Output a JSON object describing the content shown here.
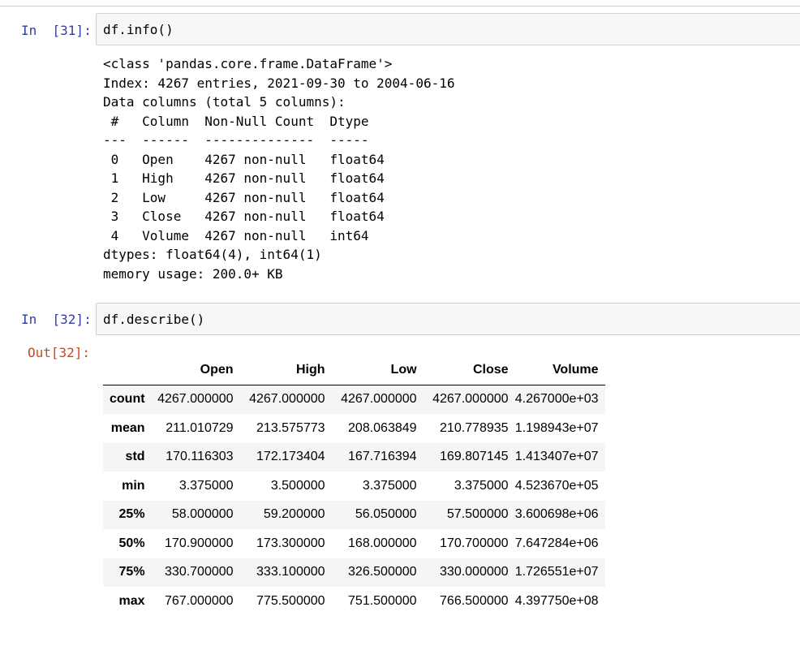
{
  "cells": [
    {
      "prompt_in": "In  [31]:",
      "code": "df.info()",
      "output_lines": [
        "<class 'pandas.core.frame.DataFrame'>",
        "Index: 4267 entries, 2021-09-30 to 2004-06-16",
        "Data columns (total 5 columns):",
        " #   Column  Non-Null Count  Dtype  ",
        "---  ------  --------------  -----  ",
        " 0   Open    4267 non-null   float64",
        " 1   High    4267 non-null   float64",
        " 2   Low     4267 non-null   float64",
        " 3   Close   4267 non-null   float64",
        " 4   Volume  4267 non-null   int64  ",
        "dtypes: float64(4), int64(1)",
        "memory usage: 200.0+ KB"
      ]
    },
    {
      "prompt_in": "In  [32]:",
      "prompt_out": "Out[32]:",
      "code": "df.describe()",
      "table": {
        "columns": [
          "",
          "Open",
          "High",
          "Low",
          "Close",
          "Volume"
        ],
        "rows": [
          [
            "count",
            "4267.000000",
            "4267.000000",
            "4267.000000",
            "4267.000000",
            "4.267000e+03"
          ],
          [
            "mean",
            "211.010729",
            "213.575773",
            "208.063849",
            "210.778935",
            "1.198943e+07"
          ],
          [
            "std",
            "170.116303",
            "172.173404",
            "167.716394",
            "169.807145",
            "1.413407e+07"
          ],
          [
            "min",
            "3.375000",
            "3.500000",
            "3.375000",
            "3.375000",
            "4.523670e+05"
          ],
          [
            "25%",
            "58.000000",
            "59.200000",
            "56.050000",
            "57.500000",
            "3.600698e+06"
          ],
          [
            "50%",
            "170.900000",
            "173.300000",
            "168.000000",
            "170.700000",
            "7.647284e+06"
          ],
          [
            "75%",
            "330.700000",
            "333.100000",
            "326.500000",
            "330.000000",
            "1.726551e+07"
          ],
          [
            "max",
            "767.000000",
            "775.500000",
            "751.500000",
            "766.500000",
            "4.397750e+08"
          ]
        ]
      }
    }
  ]
}
